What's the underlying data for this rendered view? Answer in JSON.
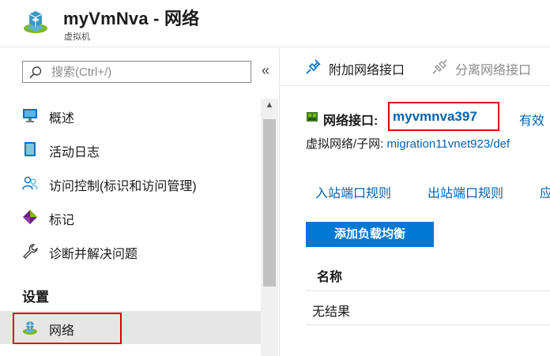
{
  "header": {
    "title": "myVmNva - 网络",
    "subtitle": "虚拟机",
    "icon": "virtual-machine-icon"
  },
  "sidebar": {
    "search_placeholder": "搜索(Ctrl+/)",
    "collapse_glyph": "«",
    "items": [
      {
        "label": "概述",
        "icon": "monitor-icon"
      },
      {
        "label": "活动日志",
        "icon": "activity-log-icon"
      },
      {
        "label": "访问控制(标识和访问管理)",
        "icon": "people-icon"
      },
      {
        "label": "标记",
        "icon": "tag-icon"
      },
      {
        "label": "诊断并解决问题",
        "icon": "wrench-icon"
      }
    ],
    "section_title": "设置",
    "selected_item": {
      "label": "网络",
      "icon": "network-icon"
    }
  },
  "toolbar": {
    "attach_label": "附加网络接口",
    "detach_label": "分离网络接口"
  },
  "nic": {
    "label": "网络接口:",
    "name": "myvmnva397",
    "effective_label": "有效"
  },
  "vnet": {
    "label": "虚拟网络/子网:",
    "value": "migration11vnet923/def"
  },
  "tabs": [
    "入站端口规则",
    "出站端口规则",
    "应"
  ],
  "add_lb_label": "添加负载均衡",
  "table": {
    "header_name": "名称",
    "empty_text": "无结果"
  },
  "colors": {
    "link": "#0063b1",
    "primary_button": "#0078d4",
    "highlight_box": "#e00000"
  }
}
